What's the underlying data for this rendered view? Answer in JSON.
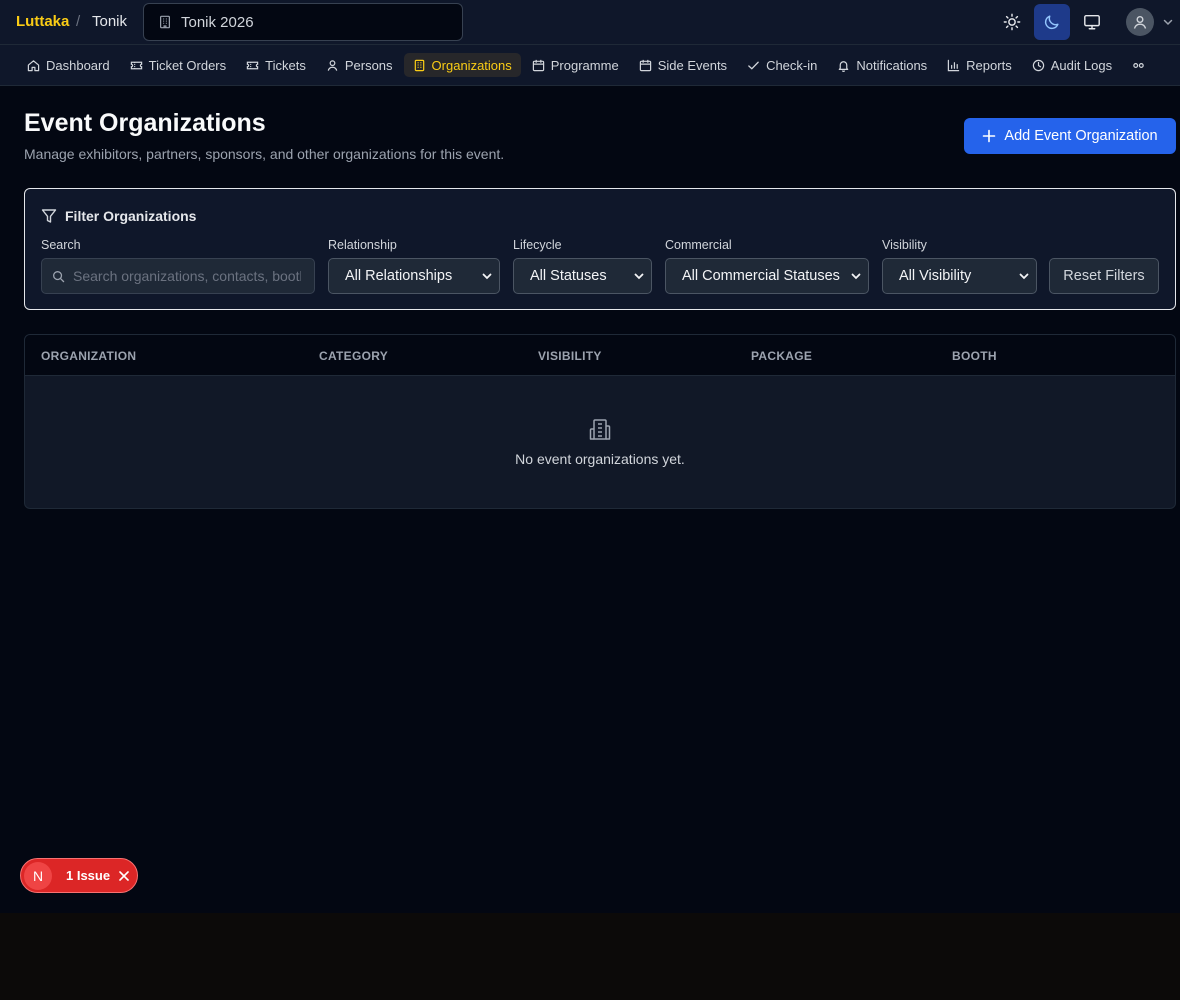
{
  "topbar": {
    "brand": "Luttaka",
    "separator": "/",
    "organization": "Tonik",
    "event_selector": "Tonik 2026"
  },
  "nav": {
    "items": [
      {
        "label": "Dashboard",
        "icon": "home-icon"
      },
      {
        "label": "Ticket Orders",
        "icon": "ticket-icon"
      },
      {
        "label": "Tickets",
        "icon": "ticket-icon"
      },
      {
        "label": "Persons",
        "icon": "user-icon"
      },
      {
        "label": "Organizations",
        "icon": "building-icon",
        "active": true
      },
      {
        "label": "Programme",
        "icon": "calendar-icon"
      },
      {
        "label": "Side Events",
        "icon": "calendar-icon"
      },
      {
        "label": "Check-in",
        "icon": "check-icon"
      },
      {
        "label": "Notifications",
        "icon": "bell-icon"
      },
      {
        "label": "Reports",
        "icon": "bar-chart-icon"
      },
      {
        "label": "Audit Logs",
        "icon": "clock-icon"
      }
    ]
  },
  "header": {
    "title": "Event Organizations",
    "subtitle": "Manage exhibitors, partners, sponsors, and other organizations for this event.",
    "add_button": "Add Event Organization"
  },
  "filters": {
    "title": "Filter Organizations",
    "search_label": "Search",
    "search_placeholder": "Search organizations, contacts, booths...",
    "relationship_label": "Relationship",
    "relationship_value": "All Relationships",
    "lifecycle_label": "Lifecycle",
    "lifecycle_value": "All Statuses",
    "commercial_label": "Commercial",
    "commercial_value": "All Commercial Statuses",
    "visibility_label": "Visibility",
    "visibility_value": "All Visibility",
    "reset_button": "Reset Filters"
  },
  "table": {
    "columns": [
      "ORGANIZATION",
      "CATEGORY",
      "VISIBILITY",
      "PACKAGE",
      "BOOTH"
    ],
    "empty_message": "No event organizations yet."
  },
  "issue_badge": {
    "initial": "N",
    "text": "1 Issue"
  },
  "colors": {
    "brand": "#facc15",
    "primary": "#2563eb",
    "issue": "#dc2626",
    "background": "#030712"
  }
}
